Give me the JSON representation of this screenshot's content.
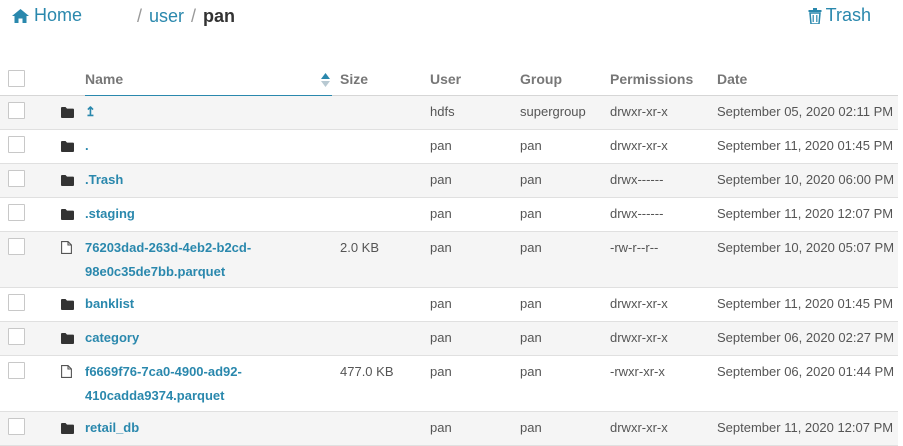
{
  "header": {
    "home_label": "Home",
    "breadcrumb": [
      {
        "label": "user",
        "current": false
      },
      {
        "label": "pan",
        "current": true
      }
    ],
    "separator": "/",
    "trash_label": "Trash"
  },
  "colors": {
    "link": "#2a88ad",
    "row_alt": "#f5f5f5"
  },
  "table": {
    "columns": {
      "name": "Name",
      "size": "Size",
      "user": "User",
      "group": "Group",
      "permissions": "Permissions",
      "date": "Date"
    },
    "sort": {
      "column": "name",
      "direction": "ascending"
    },
    "rows": [
      {
        "icon": "folder-icon",
        "name": "↥",
        "size": "",
        "user": "hdfs",
        "group": "supergroup",
        "permissions": "drwxr-xr-x",
        "date": "September 05, 2020 02:11 PM"
      },
      {
        "icon": "folder-icon",
        "name": ".",
        "size": "",
        "user": "pan",
        "group": "pan",
        "permissions": "drwxr-xr-x",
        "date": "September 11, 2020 01:45 PM"
      },
      {
        "icon": "folder-icon",
        "name": ".Trash",
        "size": "",
        "user": "pan",
        "group": "pan",
        "permissions": "drwx------",
        "date": "September 10, 2020 06:00 PM"
      },
      {
        "icon": "folder-icon",
        "name": ".staging",
        "size": "",
        "user": "pan",
        "group": "pan",
        "permissions": "drwx------",
        "date": "September 11, 2020 12:07 PM"
      },
      {
        "icon": "file-icon",
        "name": "76203dad-263d-4eb2-b2cd-98e0c35de7bb.parquet",
        "size": "2.0 KB",
        "user": "pan",
        "group": "pan",
        "permissions": "-rw-r--r--",
        "date": "September 10, 2020 05:07 PM"
      },
      {
        "icon": "folder-icon",
        "name": "banklist",
        "size": "",
        "user": "pan",
        "group": "pan",
        "permissions": "drwxr-xr-x",
        "date": "September 11, 2020 01:45 PM"
      },
      {
        "icon": "folder-icon",
        "name": "category",
        "size": "",
        "user": "pan",
        "group": "pan",
        "permissions": "drwxr-xr-x",
        "date": "September 06, 2020 02:27 PM"
      },
      {
        "icon": "file-icon",
        "name": "f6669f76-7ca0-4900-ad92-410cadda9374.parquet",
        "size": "477.0 KB",
        "user": "pan",
        "group": "pan",
        "permissions": "-rwxr-xr-x",
        "date": "September 06, 2020 01:44 PM"
      },
      {
        "icon": "folder-icon",
        "name": "retail_db",
        "size": "",
        "user": "pan",
        "group": "pan",
        "permissions": "drwxr-xr-x",
        "date": "September 11, 2020 12:07 PM"
      }
    ]
  }
}
